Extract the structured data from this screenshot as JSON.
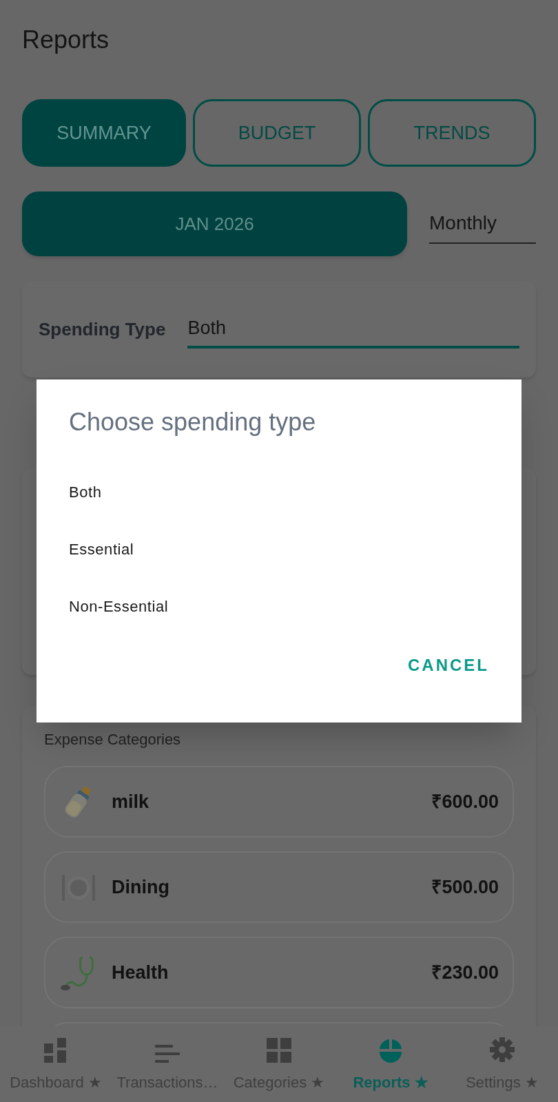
{
  "header": {
    "title": "Reports"
  },
  "tabs": [
    {
      "label": "SUMMARY",
      "selected": true
    },
    {
      "label": "BUDGET",
      "selected": false
    },
    {
      "label": "TRENDS",
      "selected": false
    }
  ],
  "period": {
    "date": "JAN 2026",
    "mode": "Monthly"
  },
  "filter": {
    "label": "Spending Type",
    "value": "Both"
  },
  "expense_categories": {
    "title": "Expense Categories",
    "items": [
      {
        "name": "milk",
        "amount": "₹600.00"
      },
      {
        "name": "Dining",
        "amount": "₹500.00"
      },
      {
        "name": "Health",
        "amount": "₹230.00"
      }
    ]
  },
  "dialog": {
    "title": "Choose spending type",
    "options": [
      "Both",
      "Essential",
      "Non-Essential"
    ],
    "cancel": "CANCEL"
  },
  "bottom_nav": [
    {
      "label": "Dashboard ★",
      "selected": false
    },
    {
      "label": "Transactions…",
      "selected": false
    },
    {
      "label": "Categories ★",
      "selected": false
    },
    {
      "label": "Reports ★",
      "selected": true
    },
    {
      "label": "Settings ★",
      "selected": false
    }
  ]
}
